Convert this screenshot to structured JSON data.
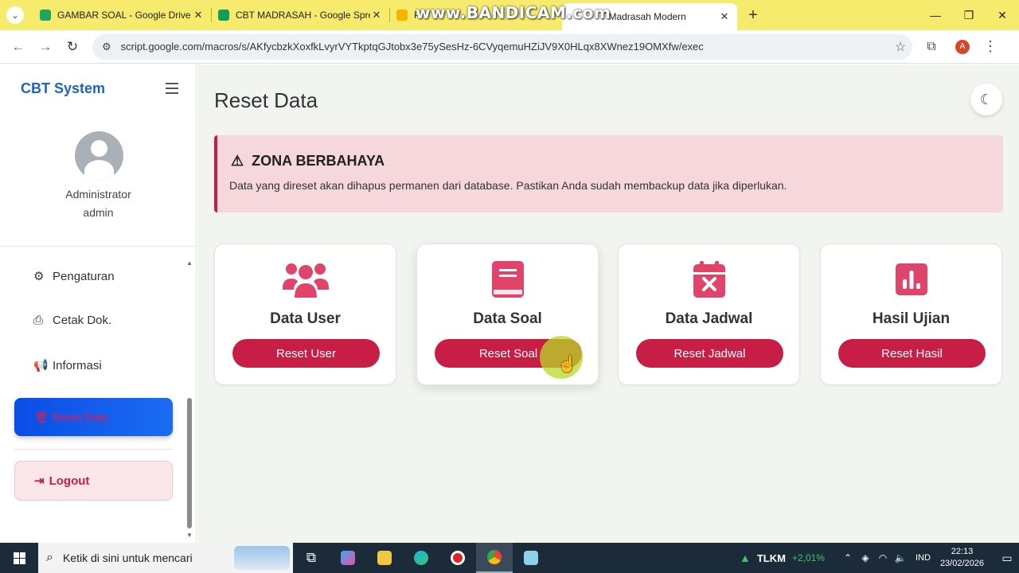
{
  "browser": {
    "tabs": [
      {
        "title": "GAMBAR SOAL - Google Drive",
        "favicon_color": "#1fa463"
      },
      {
        "title": "CBT MADRASAH - Google Spre",
        "favicon_color": "#0f9d58"
      },
      {
        "title": "Pr",
        "favicon_color": "#f4b400"
      },
      {
        "title": "T Madrasah Modern",
        "favicon_color": "#ffffff"
      }
    ],
    "watermark": "www.BANDICAM.com",
    "url": "script.google.com/macros/s/AKfycbzkXoxfkLvyrVYTkptqGJtobx3e75ySesHz-6CVyqemuHZiJV9X0HLqx8XWnez19OMXfw/exec",
    "profile_initial": "A"
  },
  "sidebar": {
    "brand": "CBT System",
    "user_role": "Administrator",
    "user_name": "admin",
    "items": [
      {
        "label": "Pengaturan",
        "icon": "gear-icon"
      },
      {
        "label": "Cetak Dok.",
        "icon": "printer-icon"
      },
      {
        "label": "Informasi",
        "icon": "megaphone-icon"
      }
    ],
    "active_item": {
      "label": "Reset Data",
      "icon": "trash-icon"
    },
    "logout": "Logout"
  },
  "main": {
    "title": "Reset Data",
    "alert": {
      "title": "ZONA BERBAHAYA",
      "text": "Data yang direset akan dihapus permanen dari database. Pastikan Anda sudah membackup data jika diperlukan."
    },
    "cards": [
      {
        "label": "Data User",
        "button": "Reset User",
        "icon": "users-icon"
      },
      {
        "label": "Data Soal",
        "button": "Reset Soal",
        "icon": "book-icon"
      },
      {
        "label": "Data Jadwal",
        "button": "Reset Jadwal",
        "icon": "calendar-x-icon"
      },
      {
        "label": "Hasil Ujian",
        "button": "Reset Hasil",
        "icon": "bar-chart-icon"
      }
    ]
  },
  "taskbar": {
    "search_placeholder": "Ketik di sini untuk mencari",
    "stock_name": "TLKM",
    "stock_change": "+2,01%",
    "language": "IND",
    "time": "22:13",
    "date": "23/02/2026"
  },
  "colors": {
    "accent": "#c81e45",
    "brand": "#1e63c6",
    "icon": "#e0446b"
  }
}
